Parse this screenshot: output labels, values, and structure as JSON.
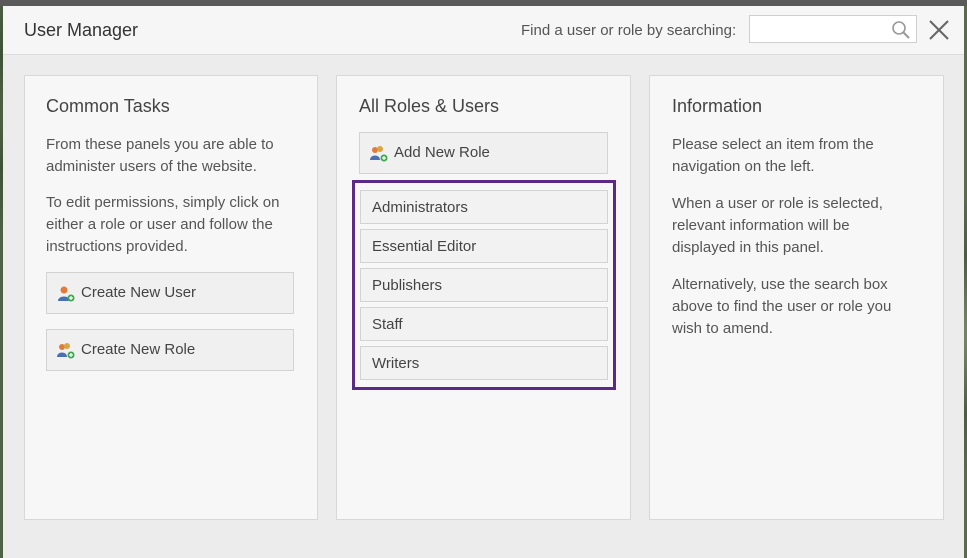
{
  "window": {
    "title": "User Manager"
  },
  "search": {
    "label": "Find a user or role by searching:",
    "value": "",
    "placeholder": ""
  },
  "panels": {
    "common": {
      "title": "Common Tasks",
      "para1": "From these panels you are able to administer users of the website.",
      "para2": "To edit permissions, simply click on either a role or user and follow the instructions provided.",
      "create_user_label": "Create New User",
      "create_role_label": "Create New Role"
    },
    "roles": {
      "title": "All Roles & Users",
      "add_role_label": "Add New Role",
      "items": [
        "Administrators",
        "Essential Editor",
        "Publishers",
        "Staff",
        "Writers"
      ]
    },
    "info": {
      "title": "Information",
      "para1": "Please select an item from the navigation on the left.",
      "para2": "When a user or role is selected, relevant information will be displayed in this panel.",
      "para3": "Alternatively, use the search box above to find the user or role you wish to amend."
    }
  },
  "colors": {
    "selection_border": "#5b2a86",
    "accent_green": "#3ea84a",
    "user_orange": "#e07b39",
    "user_blue": "#4a6fb5"
  },
  "icons": {
    "search": "search-icon",
    "close": "close-icon",
    "user_add": "user-add-icon",
    "role_add": "role-add-icon"
  }
}
